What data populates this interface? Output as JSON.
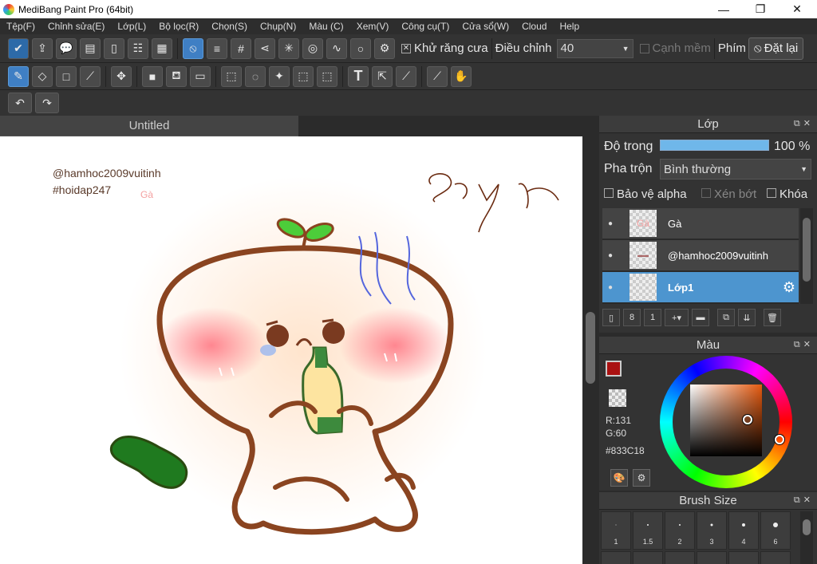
{
  "window": {
    "title": "MediBang Paint Pro (64bit)"
  },
  "menu": [
    "Tệp(F)",
    "Chỉnh sửa(E)",
    "Lớp(L)",
    "Bộ lọc(R)",
    "Chọn(S)",
    "Chụp(N)",
    "Màu (C)",
    "Xem(V)",
    "Công cụ(T)",
    "Cửa sổ(W)",
    "Cloud",
    "Help"
  ],
  "toolbar1": {
    "antialias_label": "Khử răng cưa",
    "adjust_label": "Điều chỉnh",
    "adjust_value": "40",
    "soft_edge_label": "Cạnh mềm",
    "key_label": "Phím",
    "reset_label": "Đặt lại"
  },
  "document": {
    "tab_title": "Untitled"
  },
  "canvas": {
    "text_handle": "@hamhoc2009vuitinh",
    "text_hashtag": "#hoidap247",
    "text_ga": "Gà",
    "text_sayr": "Say r"
  },
  "layer_panel": {
    "title": "Lớp",
    "opacity_label": "Độ trong",
    "opacity_value": "100 %",
    "opacity_fraction": 1.0,
    "blend_label": "Pha trộn",
    "blend_value": "Bình thường",
    "protect_alpha": "Bảo vệ alpha",
    "clipping": "Xén bớt",
    "lock": "Khóa",
    "layers": [
      {
        "name": "Gà",
        "thumb": "Gà"
      },
      {
        "name": "@hamhoc2009vuitinh",
        "thumb": ""
      },
      {
        "name": "Lớp1",
        "thumb": ""
      }
    ]
  },
  "color_panel": {
    "title": "Màu",
    "r": "R:131",
    "g": "G:60",
    "hex": "#833C18"
  },
  "brush_panel": {
    "title": "Brush Size",
    "sizes": [
      "1",
      "1.5",
      "2",
      "3",
      "4",
      "6"
    ]
  }
}
